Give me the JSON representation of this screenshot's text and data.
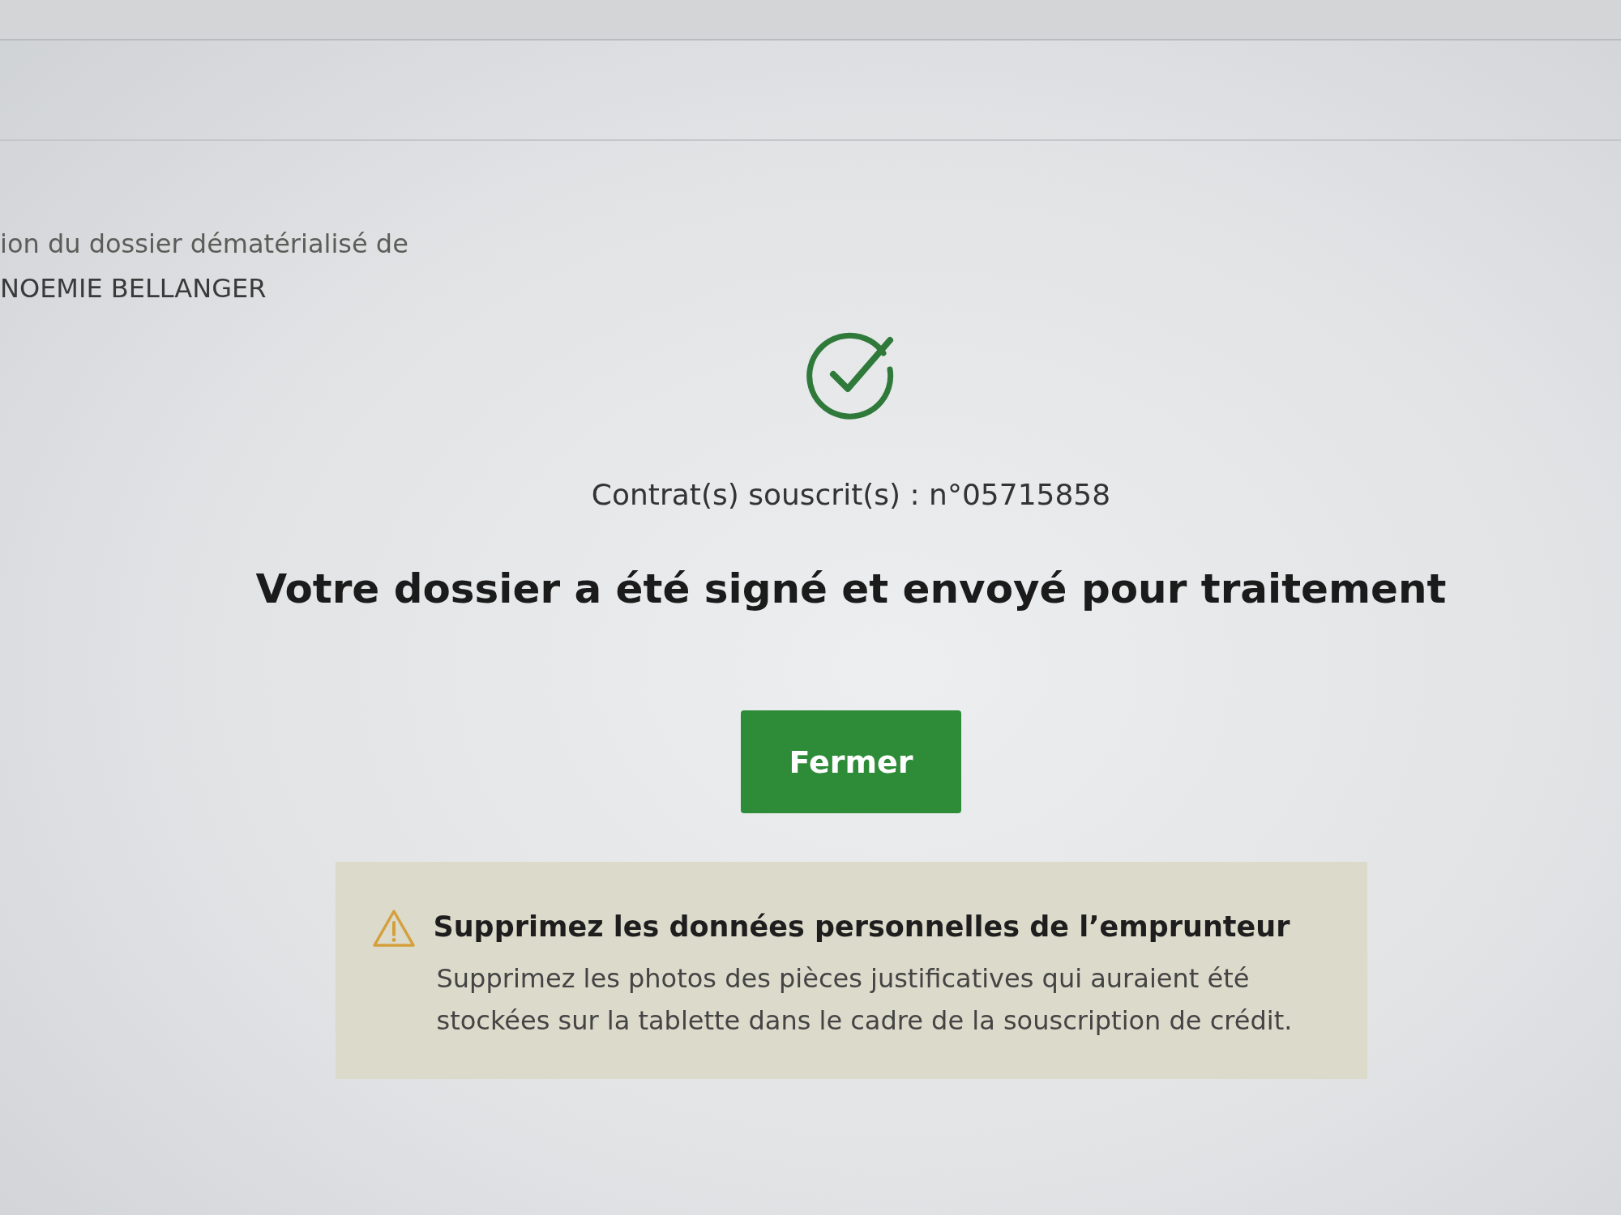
{
  "header": {
    "subtitle_lines": [
      "ion du dossier dématérialisé de",
      "NOEMIE BELLANGER"
    ]
  },
  "confirmation": {
    "kind": "success",
    "contract": "Contrat(s) souscrit(s) : n°05715858",
    "title": "Votre dossier a été signé et envoyé pour traitement",
    "button": "Fermer"
  },
  "notice": {
    "kind": "warning",
    "title": "Supprimez les données personnelles de l’emprunteur",
    "body": "Supprimez les photos des pièces justificatives qui auraient été stockées sur la tablette dans le cadre de la souscription de crédit."
  }
}
